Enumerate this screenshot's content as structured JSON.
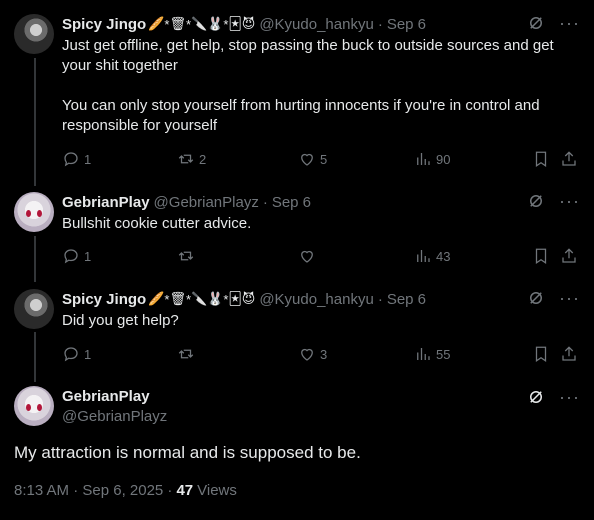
{
  "replies": [
    {
      "name": "Spicy Jingo",
      "badges": [
        "🥖",
        "*",
        "🗑",
        "*",
        "🔪",
        "🐰",
        "*",
        "🃏",
        "😈"
      ],
      "handle": "@Kyudo_hankyu",
      "date": "Sep 6",
      "paragraphs": [
        "Just get offline, get help, stop passing the buck to outside sources and get your shit together",
        "You can only stop yourself from hurting innocents if you're in control and responsible for yourself"
      ],
      "stats": {
        "replies": "1",
        "reposts": "2",
        "likes": "5",
        "views": "90"
      }
    },
    {
      "name": "GebrianPlay",
      "badges": [],
      "handle": "@GebrianPlayz",
      "date": "Sep 6",
      "paragraphs": [
        "Bullshit cookie cutter advice."
      ],
      "stats": {
        "replies": "1",
        "reposts": "",
        "likes": "",
        "views": "43"
      }
    },
    {
      "name": "Spicy Jingo",
      "badges": [
        "🥖",
        "*",
        "🗑",
        "*",
        "🔪",
        "🐰",
        "*",
        "🃏",
        "😈"
      ],
      "handle": "@Kyudo_hankyu",
      "date": "Sep 6",
      "paragraphs": [
        "Did you get help?"
      ],
      "stats": {
        "replies": "1",
        "reposts": "",
        "likes": "3",
        "views": "55"
      }
    }
  ],
  "main": {
    "name": "GebrianPlay",
    "handle": "@GebrianPlayz",
    "text": "My attraction is normal and is supposed to be.",
    "timestamp": "8:13 AM · Sep 6, 2025 ·",
    "views_count": "47",
    "views_label": "Views"
  },
  "icons": {
    "more": "···",
    "separator": "·"
  },
  "colors": {
    "background": "#000000",
    "text": "#e7e9ea",
    "muted": "#71767b",
    "line": "#333639"
  }
}
